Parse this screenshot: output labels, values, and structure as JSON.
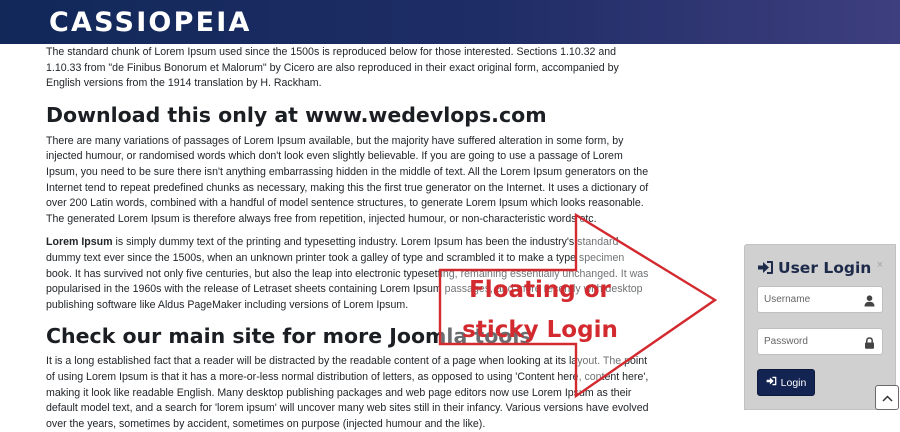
{
  "header": {
    "brand": "CASSIOPEIA",
    "gradient_colors": [
      "#112859",
      "#3e3f7e"
    ]
  },
  "article": {
    "intro_paragraph": "The standard chunk of Lorem Ipsum used since the 1500s is reproduced below for those interested. Sections 1.10.32 and 1.10.33 from \"de Finibus Bonorum et Malorum\" by Cicero are also reproduced in their exact original form, accompanied by English versions from the 1914 translation by H. Rackham.",
    "heading_1": "Download this only at www.wedevlops.com",
    "paragraph_2": "There are many variations of passages of Lorem Ipsum available, but the majority have suffered alteration in some form, by injected humour, or randomised words which don't look even slightly believable. If you are going to use a passage of Lorem Ipsum, you need to be sure there isn't anything embarrassing hidden in the middle of text. All the Lorem Ipsum generators on the Internet tend to repeat predefined chunks as necessary, making this the first true generator on the Internet. It uses a dictionary of over 200 Latin words, combined with a handful of model sentence structures, to generate Lorem Ipsum which looks reasonable. The generated Lorem Ipsum is therefore always free from repetition, injected humour, or non-characteristic words etc.",
    "paragraph_3_bold": "Lorem Ipsum",
    "paragraph_3_rest": " is simply dummy text of the printing and typesetting industry. Lorem Ipsum has been the industry's standard dummy text ever since the 1500s, when an unknown printer took a galley of type and scrambled it to make a type specimen book. It has survived not only five centuries, but also the leap into electronic typesetting, remaining essentially unchanged. It was popularised in the 1960s with the release of Letraset sheets containing Lorem Ipsum passages, and more recently with desktop publishing software like Aldus PageMaker including versions of Lorem Ipsum.",
    "heading_2": "Check our main site for more Joomla tools",
    "paragraph_4": "It is a long established fact that a reader will be distracted by the readable content of a page when looking at its layout. The point of using Lorem Ipsum is that it has a more-or-less normal distribution of letters, as opposed to using 'Content here, content here', making it look like readable English. Many desktop publishing packages and web page editors now use Lorem Ipsum as their default model text, and a search for 'lorem ipsum' will uncover many web sites still in their infancy. Various versions have evolved over the years, sometimes by accident, sometimes on purpose (injected humour and the like)."
  },
  "annotation": {
    "line_1": "Floating or",
    "line_2": "sticky Login",
    "color": "#d32a2f"
  },
  "login": {
    "title": "User Login",
    "close_glyph": "×",
    "username_placeholder": "Username",
    "password_placeholder": "Password",
    "button_label": "Login",
    "panel_color": "#d0d0d0",
    "button_color": "#132452"
  },
  "icons": {
    "title": "sign-in-icon",
    "username": "user-icon",
    "password": "lock-icon",
    "button": "sign-in-icon",
    "scroll_top": "chevron-up-icon"
  }
}
